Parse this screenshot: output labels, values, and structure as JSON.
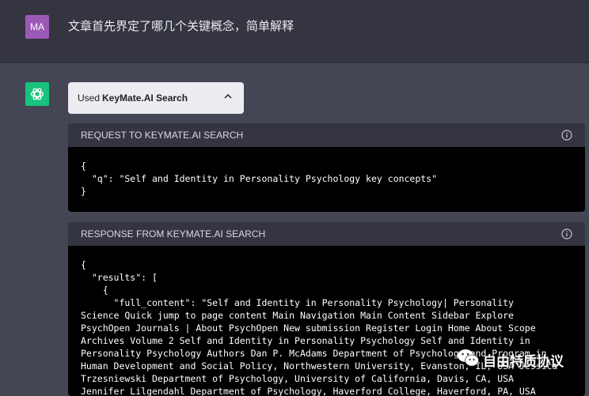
{
  "user": {
    "avatar_initials": "MA",
    "message": "文章首先界定了哪几个关键概念，简单解释"
  },
  "plugin": {
    "used_prefix": "Used",
    "name": "KeyMate.AI Search",
    "chevron_icon": "chevron-up-icon"
  },
  "request": {
    "title": "REQUEST TO KEYMATE.AI SEARCH",
    "body": "{\n  \"q\": \"Self and Identity in Personality Psychology key concepts\"\n}"
  },
  "response": {
    "title": "RESPONSE FROM KEYMATE.AI SEARCH",
    "body": "{\n  \"results\": [\n    {\n      \"full_content\": \"Self and Identity in Personality Psychology| Personality\nScience Quick jump to page content Main Navigation Main Content Sidebar Explore\nPsychOpen Journals | About PsychOpen New submission Register Login Home About Scope\nArchives Volume 2 Self and Identity in Personality Psychology Self and Identity in\nPersonality Psychology Authors Dan P. McAdams Department of Psychology and Program in\nHuman Development and Social Policy, Northwestern University, Evanston, IL, USA Jessica\nTrzesniewski Department of Psychology, University of California, Davis, CA, USA\nJennifer Lilgendahl Department of Psychology, Haverford College, Haverford, PA, USA"
  },
  "watermark": {
    "text": "自由特质协议"
  },
  "colors": {
    "user_bg": "#343541",
    "assistant_bg": "#444654",
    "gpt_avatar": "#19c37d",
    "user_avatar": "#9b59b6"
  }
}
